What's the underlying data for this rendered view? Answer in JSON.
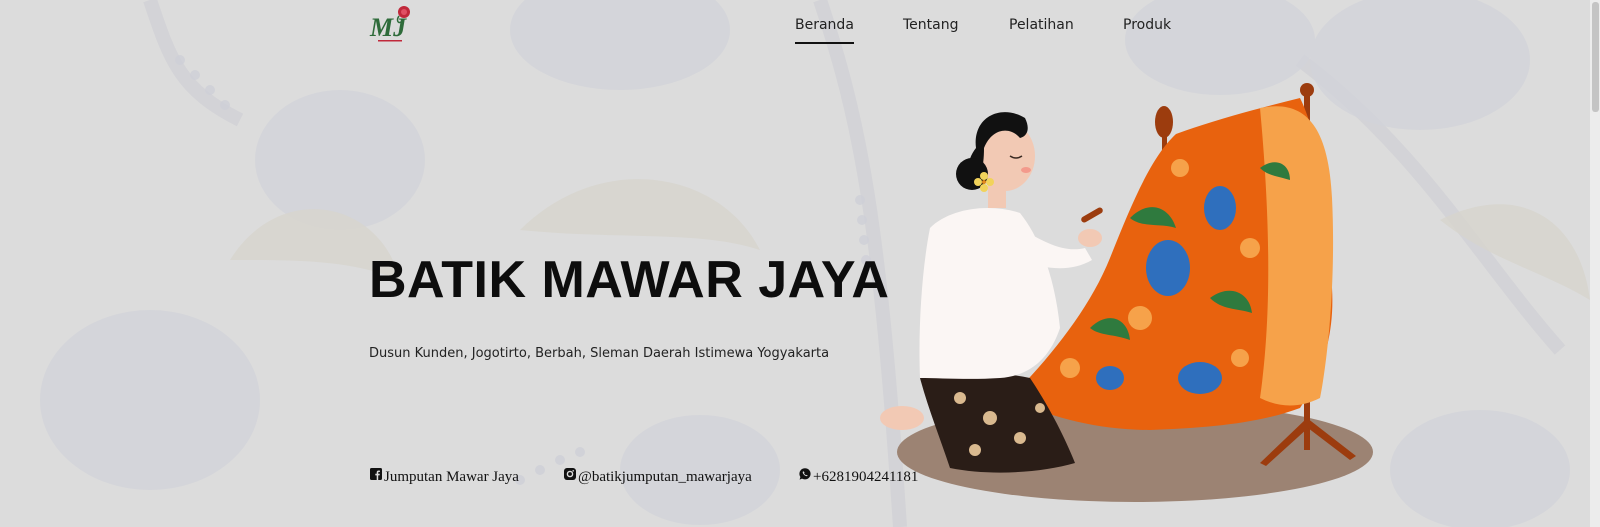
{
  "brand": {
    "logo_icon": "mj-rose-logo-icon",
    "logo_text": "MJ"
  },
  "nav": {
    "items": [
      {
        "label": "Beranda",
        "active": true
      },
      {
        "label": "Tentang",
        "active": false
      },
      {
        "label": "Pelatihan",
        "active": false
      },
      {
        "label": "Produk",
        "active": false
      }
    ]
  },
  "hero": {
    "title": "BATIK MAWAR JAYA",
    "address": "Dusun Kunden, Jogotirto, Berbah, Sleman Daerah Istimewa Yogyakarta",
    "illustration": "woman-painting-batik-illustration"
  },
  "social": {
    "facebook": {
      "icon": "facebook-icon",
      "label": "Jumputan Mawar Jaya"
    },
    "instagram": {
      "icon": "instagram-icon",
      "label": "@batikjumputan_mawarjaya"
    },
    "whatsapp": {
      "icon": "whatsapp-icon",
      "label": "+6281904241181"
    }
  },
  "colors": {
    "background": "#dcdcdc",
    "batik_orange": "#e8620e",
    "text_dark": "#0d0d0d",
    "logo_green": "#2e6b3a",
    "logo_red": "#c0283a"
  }
}
